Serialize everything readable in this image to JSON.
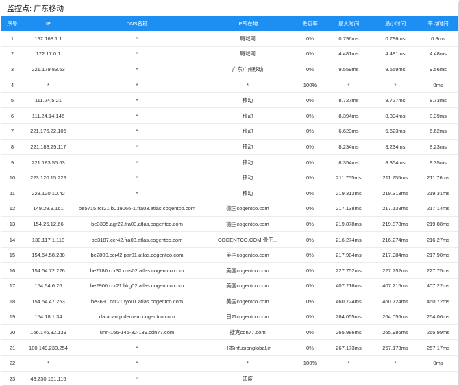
{
  "monitor_title": "监控点: 广东移动",
  "columns": [
    "序号",
    "IP",
    "DNS名称",
    "IP所在地",
    "丢包率",
    "最大时间",
    "最小时间",
    "平均时间"
  ],
  "rows": [
    [
      "1",
      "192.168.1.1",
      "*",
      "局域网",
      "0%",
      "0.796ms",
      "0.796ms",
      "0.8ms"
    ],
    [
      "2",
      "172.17.0.1",
      "*",
      "局域网",
      "0%",
      "4.481ms",
      "4.481ms",
      "4.48ms"
    ],
    [
      "3",
      "221.179.83.53",
      "*",
      "广东广州移动",
      "0%",
      "9.559ms",
      "9.559ms",
      "9.56ms"
    ],
    [
      "4",
      "*",
      "*",
      "*",
      "100%",
      "*",
      "*",
      "0ms"
    ],
    [
      "5",
      "111.24.5.21",
      "*",
      "移动",
      "0%",
      "8.727ms",
      "8.727ms",
      "8.73ms"
    ],
    [
      "6",
      "111.24.14.146",
      "*",
      "移动",
      "0%",
      "8.394ms",
      "8.394ms",
      "8.39ms"
    ],
    [
      "7",
      "221.176.22.106",
      "*",
      "移动",
      "0%",
      "6.623ms",
      "6.623ms",
      "6.62ms"
    ],
    [
      "8",
      "221.183.25.117",
      "*",
      "移动",
      "0%",
      "8.234ms",
      "8.234ms",
      "8.23ms"
    ],
    [
      "9",
      "221.183.55.53",
      "*",
      "移动",
      "0%",
      "8.354ms",
      "8.354ms",
      "8.35ms"
    ],
    [
      "10",
      "223.120.15.229",
      "*",
      "移动",
      "0%",
      "211.755ms",
      "211.755ms",
      "211.76ms"
    ],
    [
      "11",
      "223.120.10.42",
      "*",
      "移动",
      "0%",
      "219.313ms",
      "219.313ms",
      "219.31ms"
    ],
    [
      "12",
      "149.29.9.161",
      "be5715.rcr21.b019066-1.fra03.atlas.cogentco.com",
      "德国cogentco.com",
      "0%",
      "217.138ms",
      "217.138ms",
      "217.14ms"
    ],
    [
      "13",
      "154.25.12.66",
      "be3395.agr22.fra03.atlas.cogentco.com",
      "德国cogentco.com",
      "0%",
      "219.878ms",
      "219.878ms",
      "219.88ms"
    ],
    [
      "14",
      "130.117.1.118",
      "be3187.ccr42.fra03.atlas.cogentco.com",
      "COGENTCO.COM 骨干...",
      "0%",
      "216.274ms",
      "216.274ms",
      "216.27ms"
    ],
    [
      "15",
      "154.54.58.238",
      "be2800.ccr42.par01.atlas.cogentco.com",
      "美国cogentco.com",
      "0%",
      "217.984ms",
      "217.984ms",
      "217.98ms"
    ],
    [
      "16",
      "154.54.72.226",
      "be2780.ccr32.mrs02.atlas.cogentco.com",
      "美国cogentco.com",
      "0%",
      "227.752ms",
      "227.752ms",
      "227.75ms"
    ],
    [
      "17",
      "154.54.6.26",
      "be2900.ccr21.hkg02.atlas.cogentco.com",
      "美国cogentco.com",
      "0%",
      "407.216ms",
      "407.216ms",
      "407.22ms"
    ],
    [
      "18",
      "154.54.47.253",
      "be3690.ccr21.tyo01.atlas.cogentco.com",
      "美国cogentco.com",
      "0%",
      "460.724ms",
      "460.724ms",
      "460.72ms"
    ],
    [
      "19",
      "154.18.1.34",
      "datacamp.demarc.cogentco.com",
      "日本cogentco.com",
      "0%",
      "264.055ms",
      "264.055ms",
      "264.06ms"
    ],
    [
      "20",
      "156.146.32.139",
      "unn-156-146-32-139.cdn77.com",
      "搜克cdn77.com",
      "0%",
      "265.986ms",
      "265.986ms",
      "265.99ms"
    ],
    [
      "21",
      "180.149.230.254",
      "*",
      "日本infusionglobal.in",
      "0%",
      "267.173ms",
      "267.173ms",
      "267.17ms"
    ],
    [
      "22",
      "*",
      "*",
      "*",
      "100%",
      "*",
      "*",
      "0ms"
    ],
    [
      "23",
      "43.230.161.116",
      "*",
      "印度",
      "",
      "",
      "",
      ""
    ]
  ]
}
